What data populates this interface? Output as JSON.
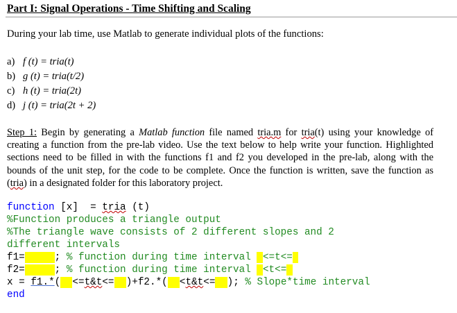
{
  "title": "Part I: Signal Operations - Time Shifting and Scaling",
  "intro": "During your lab time, use Matlab to generate individual plots of the functions:",
  "functions": [
    {
      "label": "a)",
      "expr": "f (t) = tria(t)"
    },
    {
      "label": "b)",
      "expr": "g (t) = tria(t/2)"
    },
    {
      "label": "c)",
      "expr": "h (t) = tria(2t)"
    },
    {
      "label": "d)",
      "expr": "j (t) = tria(2t + 2)"
    }
  ],
  "step1": {
    "label": "Step 1:",
    "t1": " Begin by generating a ",
    "em": "Matlab function",
    "t2": " file named ",
    "file": "tria.m",
    "t3": " for ",
    "fn": "tria",
    "t4": "(t) using your knowledge of creating a function from the pre-lab video. Use the text below to help write your function. Highlighted sections need to be filled in with the functions f1 and f2 you developed in the pre-lab, along with the bounds of the unit step, for the code to be complete. Once the function is written, save the function as (",
    "fn2": "tria",
    "t5": ") in a designated folder for this laboratory project."
  },
  "code": {
    "kw_function": "function",
    "sig_mid": " [x]  = ",
    "sig_name": "tria",
    "sig_end": " (t)",
    "comment1": "%Function produces a triangle output",
    "comment2a": "%The triangle wave consists of 2 different slopes and 2",
    "comment2b": "different intervals",
    "f1_label": "f1=",
    "f1_blank": "     ",
    "f1_sep": "; ",
    "f1_comment": "% function during time interval ",
    "f1_int_a": " ",
    "f1_int_b": "<=t<=",
    "f1_int_c": " ",
    "f2_label": "f2=",
    "f2_blank": "     ",
    "f2_sep": "; ",
    "f2_comment": "% function during time interval ",
    "f2_int_a": " ",
    "f2_int_b": "<t<=",
    "f2_int_c": " ",
    "x_a": "x = ",
    "x_f1": "f1.*",
    "x_b": "(",
    "x_h1": "  ",
    "x_c": "<=",
    "x_t1": "t&t",
    "x_d": "<=",
    "x_h2": "  ",
    "x_e": ")+f2.*(",
    "x_h3": "  ",
    "x_f": "<",
    "x_t2": "t&t",
    "x_g": "<=",
    "x_h4": "  ",
    "x_h": "); ",
    "x_comment": "% Slope*time interval",
    "kw_end": "end"
  }
}
